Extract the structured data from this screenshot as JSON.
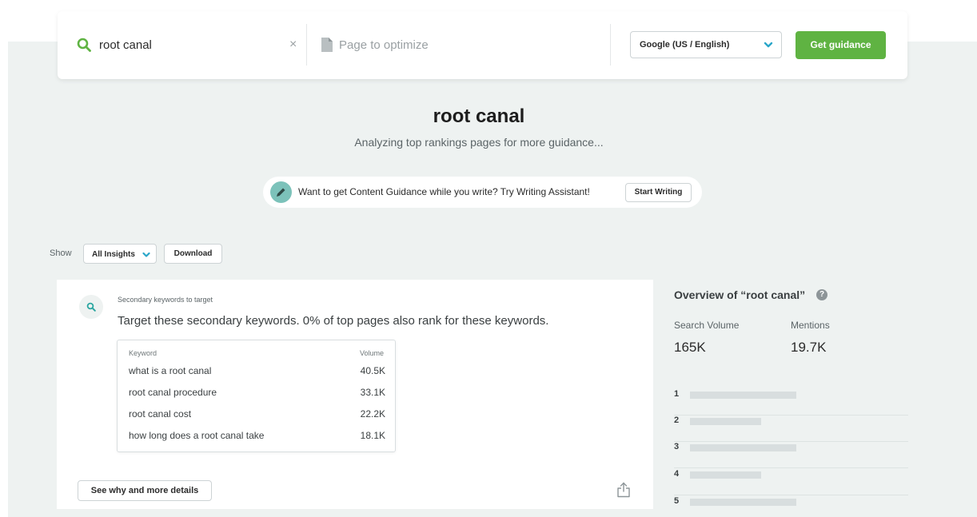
{
  "search": {
    "keyword_value": "root canal",
    "clear_label": "×",
    "page_placeholder": "Page to optimize",
    "engine_selected": "Google (US / English)",
    "guidance_button": "Get guidance",
    "accent_color": "#5fb342"
  },
  "heading": {
    "title": "root canal",
    "subtitle": "Analyzing top rankings pages for more guidance..."
  },
  "writing_assistant": {
    "text": "Want to get Content Guidance while you write? Try Writing Assistant!",
    "button": "Start Writing"
  },
  "filters": {
    "show_label": "Show",
    "insights_selected": "All Insights",
    "download_label": "Download"
  },
  "insight": {
    "label": "Secondary keywords to target",
    "description": "Target these secondary keywords. 0% of top pages also rank for these keywords.",
    "columns": [
      "Keyword",
      "Volume"
    ],
    "rows": [
      {
        "keyword": "what is a root canal",
        "volume": "40.5K"
      },
      {
        "keyword": "root canal procedure",
        "volume": "33.1K"
      },
      {
        "keyword": "root canal cost",
        "volume": "22.2K"
      },
      {
        "keyword": "how long does a root canal take",
        "volume": "18.1K"
      }
    ],
    "details_button": "See why and more details"
  },
  "overview": {
    "title": "Overview of “root canal”",
    "search_volume_label": "Search Volume",
    "search_volume_value": "165K",
    "mentions_label": "Mentions",
    "mentions_value": "19.7K",
    "ranks": [
      "1",
      "2",
      "3",
      "4",
      "5"
    ]
  }
}
